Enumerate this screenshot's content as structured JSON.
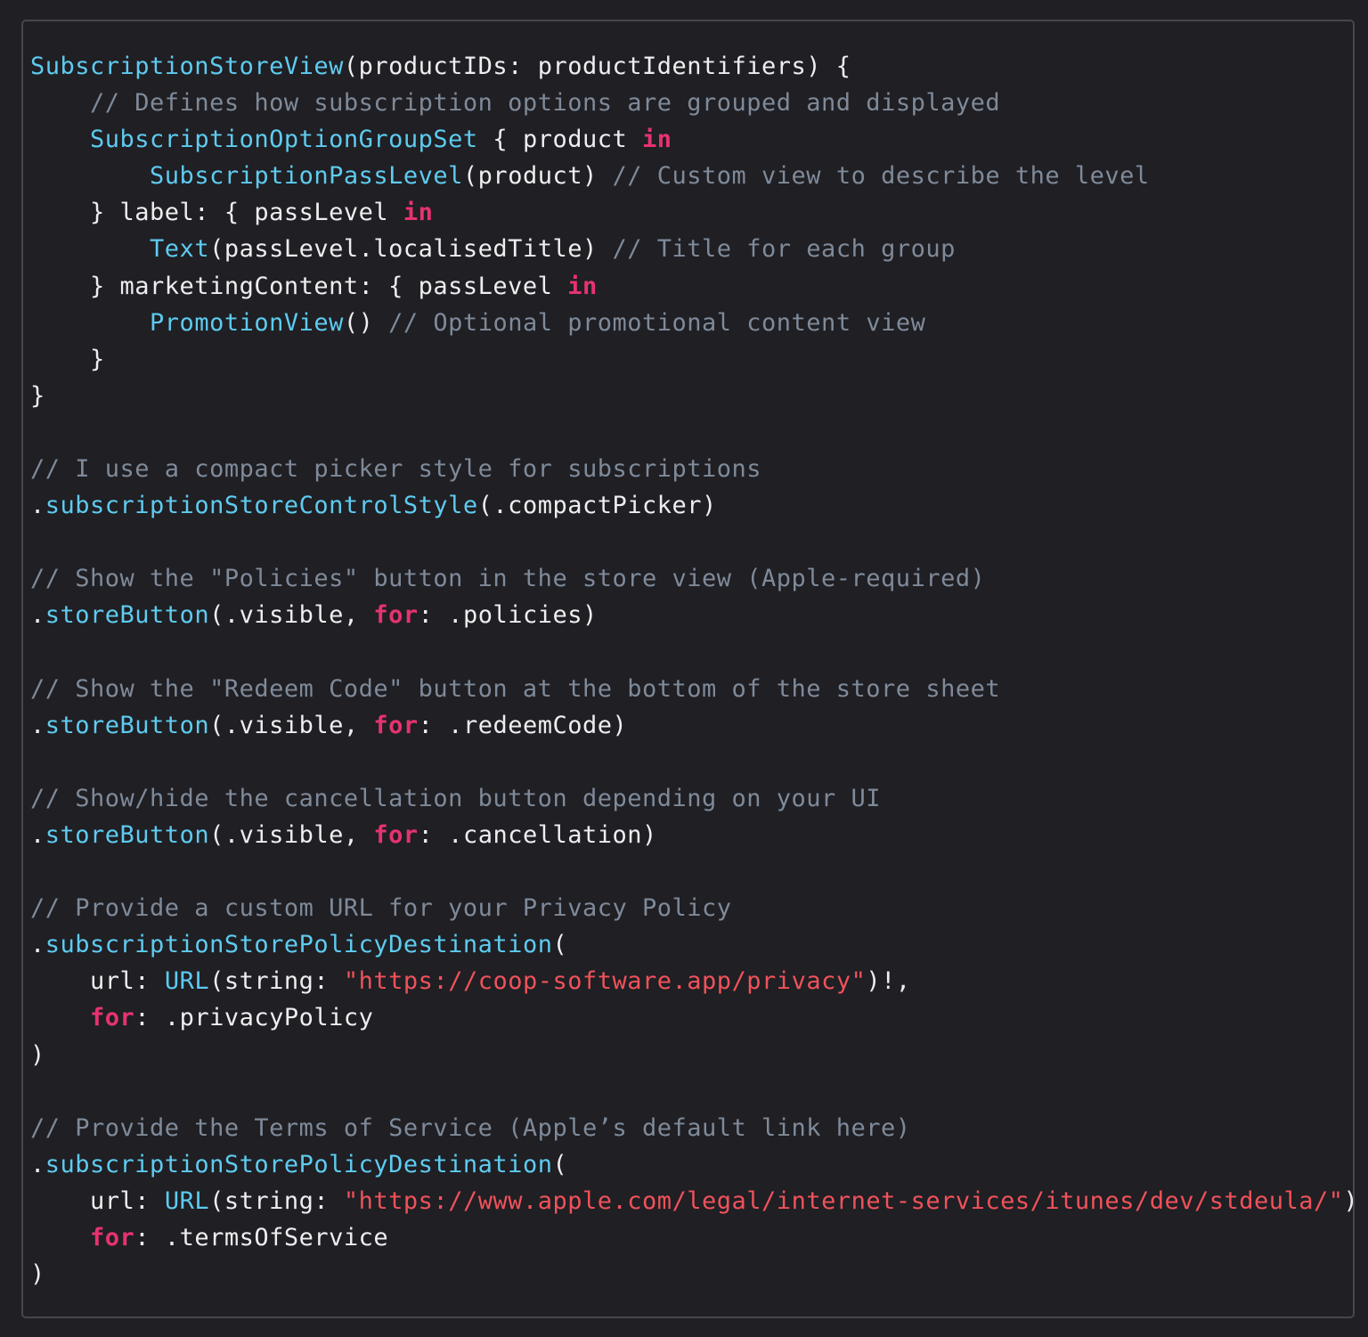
{
  "colors": {
    "background": "#1f1f24",
    "border": "#46464d",
    "plain": "#eeeef0",
    "type": "#5ecbef",
    "keyword": "#e6336f",
    "comment": "#7f8a99",
    "string": "#f0525a"
  },
  "code_lines": [
    [
      [
        "type",
        "SubscriptionStoreView"
      ],
      [
        "plain",
        "(productIDs: productIdentifiers) {"
      ]
    ],
    [
      [
        "plain",
        "    "
      ],
      [
        "comment",
        "// Defines how subscription options are grouped and displayed"
      ]
    ],
    [
      [
        "plain",
        "    "
      ],
      [
        "type",
        "SubscriptionOptionGroupSet"
      ],
      [
        "plain",
        " { product "
      ],
      [
        "kw",
        "in"
      ]
    ],
    [
      [
        "plain",
        "        "
      ],
      [
        "type",
        "SubscriptionPassLevel"
      ],
      [
        "plain",
        "(product) "
      ],
      [
        "comment",
        "// Custom view to describe the level"
      ]
    ],
    [
      [
        "plain",
        "    } label: { passLevel "
      ],
      [
        "kw",
        "in"
      ]
    ],
    [
      [
        "plain",
        "        "
      ],
      [
        "type",
        "Text"
      ],
      [
        "plain",
        "(passLevel.localisedTitle) "
      ],
      [
        "comment",
        "// Title for each group"
      ]
    ],
    [
      [
        "plain",
        "    } marketingContent: { passLevel "
      ],
      [
        "kw",
        "in"
      ]
    ],
    [
      [
        "plain",
        "        "
      ],
      [
        "type",
        "PromotionView"
      ],
      [
        "plain",
        "() "
      ],
      [
        "comment",
        "// Optional promotional content view"
      ]
    ],
    [
      [
        "plain",
        "    }"
      ]
    ],
    [
      [
        "plain",
        "}"
      ]
    ],
    [],
    [
      [
        "comment",
        "// I use a compact picker style for subscriptions"
      ]
    ],
    [
      [
        "plain",
        "."
      ],
      [
        "type",
        "subscriptionStoreControlStyle"
      ],
      [
        "plain",
        "(.compactPicker)"
      ]
    ],
    [],
    [
      [
        "comment",
        "// Show the \"Policies\" button in the store view (Apple-required)"
      ]
    ],
    [
      [
        "plain",
        "."
      ],
      [
        "type",
        "storeButton"
      ],
      [
        "plain",
        "(.visible, "
      ],
      [
        "kw",
        "for"
      ],
      [
        "plain",
        ": .policies)"
      ]
    ],
    [],
    [
      [
        "comment",
        "// Show the \"Redeem Code\" button at the bottom of the store sheet"
      ]
    ],
    [
      [
        "plain",
        "."
      ],
      [
        "type",
        "storeButton"
      ],
      [
        "plain",
        "(.visible, "
      ],
      [
        "kw",
        "for"
      ],
      [
        "plain",
        ": .redeemCode)"
      ]
    ],
    [],
    [
      [
        "comment",
        "// Show/hide the cancellation button depending on your UI"
      ]
    ],
    [
      [
        "plain",
        "."
      ],
      [
        "type",
        "storeButton"
      ],
      [
        "plain",
        "(.visible, "
      ],
      [
        "kw",
        "for"
      ],
      [
        "plain",
        ": .cancellation)"
      ]
    ],
    [],
    [
      [
        "comment",
        "// Provide a custom URL for your Privacy Policy"
      ]
    ],
    [
      [
        "plain",
        "."
      ],
      [
        "type",
        "subscriptionStorePolicyDestination"
      ],
      [
        "plain",
        "("
      ]
    ],
    [
      [
        "plain",
        "    url: "
      ],
      [
        "type",
        "URL"
      ],
      [
        "plain",
        "(string: "
      ],
      [
        "str",
        "\"https://coop-software.app/privacy\""
      ],
      [
        "plain",
        ")!,"
      ]
    ],
    [
      [
        "plain",
        "    "
      ],
      [
        "kw",
        "for"
      ],
      [
        "plain",
        ": .privacyPolicy"
      ]
    ],
    [
      [
        "plain",
        ")"
      ]
    ],
    [],
    [
      [
        "comment",
        "// Provide the Terms of Service (Apple’s default link here)"
      ]
    ],
    [
      [
        "plain",
        "."
      ],
      [
        "type",
        "subscriptionStorePolicyDestination"
      ],
      [
        "plain",
        "("
      ]
    ],
    [
      [
        "plain",
        "    url: "
      ],
      [
        "type",
        "URL"
      ],
      [
        "plain",
        "(string: "
      ],
      [
        "str",
        "\"https://www.apple.com/legal/internet-services/itunes/dev/stdeula/\""
      ],
      [
        "plain",
        ")!"
      ]
    ],
    [
      [
        "plain",
        "    "
      ],
      [
        "kw",
        "for"
      ],
      [
        "plain",
        ": .termsOfService"
      ]
    ],
    [
      [
        "plain",
        ")"
      ]
    ]
  ]
}
